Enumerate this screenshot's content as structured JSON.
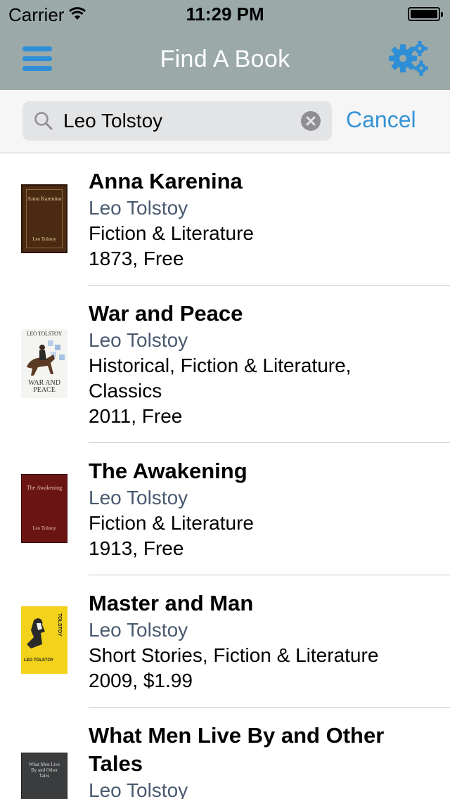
{
  "status_bar": {
    "carrier": "Carrier",
    "time": "11:29 PM"
  },
  "nav": {
    "title": "Find A Book"
  },
  "search": {
    "value": "Leo Tolstoy",
    "cancel_label": "Cancel"
  },
  "colors": {
    "nav_bar": "#9ba9a9",
    "accent": "#3593d6",
    "author_text": "#4a5a70"
  },
  "books": [
    {
      "title": "Anna Karenina",
      "author": "Leo Tolstoy",
      "genre": "Fiction & Literature",
      "year_price": "1873, Free",
      "cover": {
        "title": "Anna Karenina",
        "author": "Leo Tolstoy"
      }
    },
    {
      "title": "War and Peace",
      "author": "Leo Tolstoy",
      "genre_lines": [
        "Historical, Fiction & Literature,",
        "Classics"
      ],
      "year_price": "2011, Free",
      "cover": {
        "title": "WAR AND PEACE",
        "author": "LEO TOLSTOY"
      }
    },
    {
      "title": "The Awakening",
      "author": "Leo Tolstoy",
      "genre": "Fiction & Literature",
      "year_price": "1913, Free",
      "cover": {
        "title": "The Awakening",
        "author": "Leo Tolstoy"
      }
    },
    {
      "title": "Master and Man",
      "author": "Leo Tolstoy",
      "genre": "Short Stories, Fiction & Literature",
      "year_price": "2009, $1.99",
      "cover": {
        "title": "TOLSTOY",
        "author": "LEO TOLSTOY"
      }
    },
    {
      "title_lines": [
        "What Men Live By and Other",
        "Tales"
      ],
      "author": "Leo Tolstoy",
      "cover": {
        "title": "What Men Live By and Other Tales"
      }
    }
  ]
}
